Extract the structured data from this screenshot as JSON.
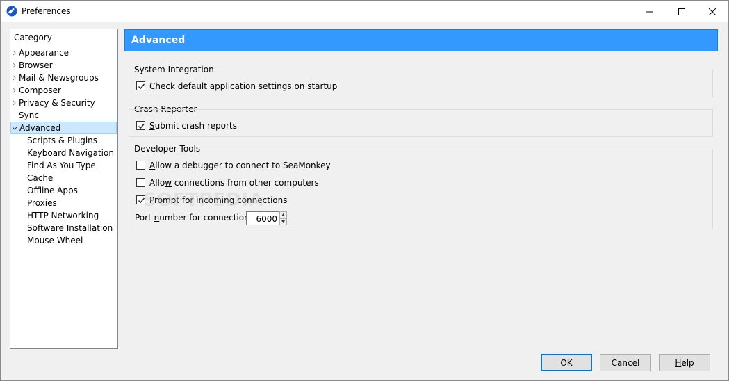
{
  "window": {
    "title": "Preferences"
  },
  "colors": {
    "header_bg": "#3399ff",
    "selection_bg": "#cce8ff",
    "default_button_border": "#0078d7"
  },
  "sidebar": {
    "header": "Category",
    "items": [
      {
        "label": "Appearance",
        "expandable": true
      },
      {
        "label": "Browser",
        "expandable": true
      },
      {
        "label": "Mail & Newsgroups",
        "expandable": true
      },
      {
        "label": "Composer",
        "expandable": true
      },
      {
        "label": "Privacy & Security",
        "expandable": true
      },
      {
        "label": "Sync",
        "expandable": false
      },
      {
        "label": "Advanced",
        "expandable": true,
        "expanded": true,
        "selected": true
      },
      {
        "label": "Scripts & Plugins"
      },
      {
        "label": "Keyboard Navigation"
      },
      {
        "label": "Find As You Type"
      },
      {
        "label": "Cache"
      },
      {
        "label": "Offline Apps"
      },
      {
        "label": "Proxies"
      },
      {
        "label": "HTTP Networking"
      },
      {
        "label": "Software Installation"
      },
      {
        "label": "Mouse Wheel"
      }
    ]
  },
  "panel": {
    "title": "Advanced",
    "system_integration": {
      "label": "System Integration",
      "check_default_pre": "",
      "check_default_mn": "C",
      "check_default_post": "heck default application settings on startup",
      "check_default_checked": true
    },
    "crash_reporter": {
      "label": "Crash Reporter",
      "submit_pre": "",
      "submit_mn": "S",
      "submit_post": "ubmit crash reports",
      "submit_checked": true
    },
    "developer_tools": {
      "label": "Developer Tools",
      "allow_debugger_pre": "",
      "allow_debugger_mn": "A",
      "allow_debugger_post": "llow a debugger to connect to SeaMonkey",
      "allow_debugger_checked": false,
      "allow_remote_pre": "Allo",
      "allow_remote_mn": "w",
      "allow_remote_post": " connections from other computers",
      "allow_remote_checked": false,
      "prompt_pre": "",
      "prompt_mn": "P",
      "prompt_post": "rompt for incoming connections",
      "prompt_checked": true,
      "port_label_pre": "Port ",
      "port_label_mn": "n",
      "port_label_post": "umber for connection:",
      "port_value": "6000"
    }
  },
  "watermark": "SOFTPEDIA",
  "buttons": {
    "ok": "OK",
    "cancel": "Cancel",
    "help_mn": "H",
    "help_post": "elp"
  }
}
